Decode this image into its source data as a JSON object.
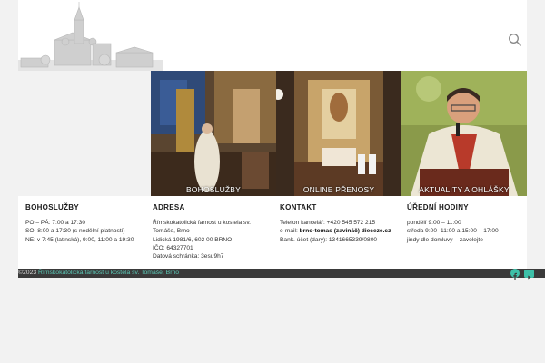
{
  "header": {
    "logo_icon": "church-drawing-icon",
    "search_icon": "search-icon"
  },
  "tiles": [
    {
      "label": "BOHOSLUŽBY"
    },
    {
      "label": "ONLINE PŘENOSY"
    },
    {
      "label": "AKTUALITY A OHLÁŠKY"
    }
  ],
  "info": {
    "services": {
      "title": "BOHOSLUŽBY",
      "lines": [
        "PO – PÁ: 7:00 a 17:30",
        "SO: 8:00 a 17:30 (s nedělní platností)",
        "NE: v 7:45 (latinská), 9:00, 11:00 a 19:30"
      ]
    },
    "address": {
      "title": "ADRESA",
      "lines": [
        "Římskokatolická farnost u kostela sv.",
        "Tomáše, Brno",
        "Lidická 1981/6, 602 00  BRNO",
        "IČO:   64327701",
        "Datová schránka:    3esu9h7"
      ]
    },
    "contact": {
      "title": "KONTAKT",
      "phone": "Telefon kancelář: +420 545 572 215",
      "email_label": "e-mail: ",
      "email_value": "brno-tomas (zavináč) dieceze.cz",
      "bank": "Bank. účet (dary): 1341665339/0800"
    },
    "hours": {
      "title": "ÚŘEDNÍ HODINY",
      "lines": [
        "pondělí 9:00 – 11:00",
        "středa 9:00 -11:00 a 15:00 – 17:00",
        "jindy dle domluvy – zavolejte"
      ]
    }
  },
  "footer": {
    "copyright": "©2023 ",
    "link": "Římskokatolická farnost u kostela sv. Tomáše, Brno",
    "social_icons": [
      "facebook-icon",
      "youtube-icon"
    ],
    "accent": "#3dc0a8"
  }
}
